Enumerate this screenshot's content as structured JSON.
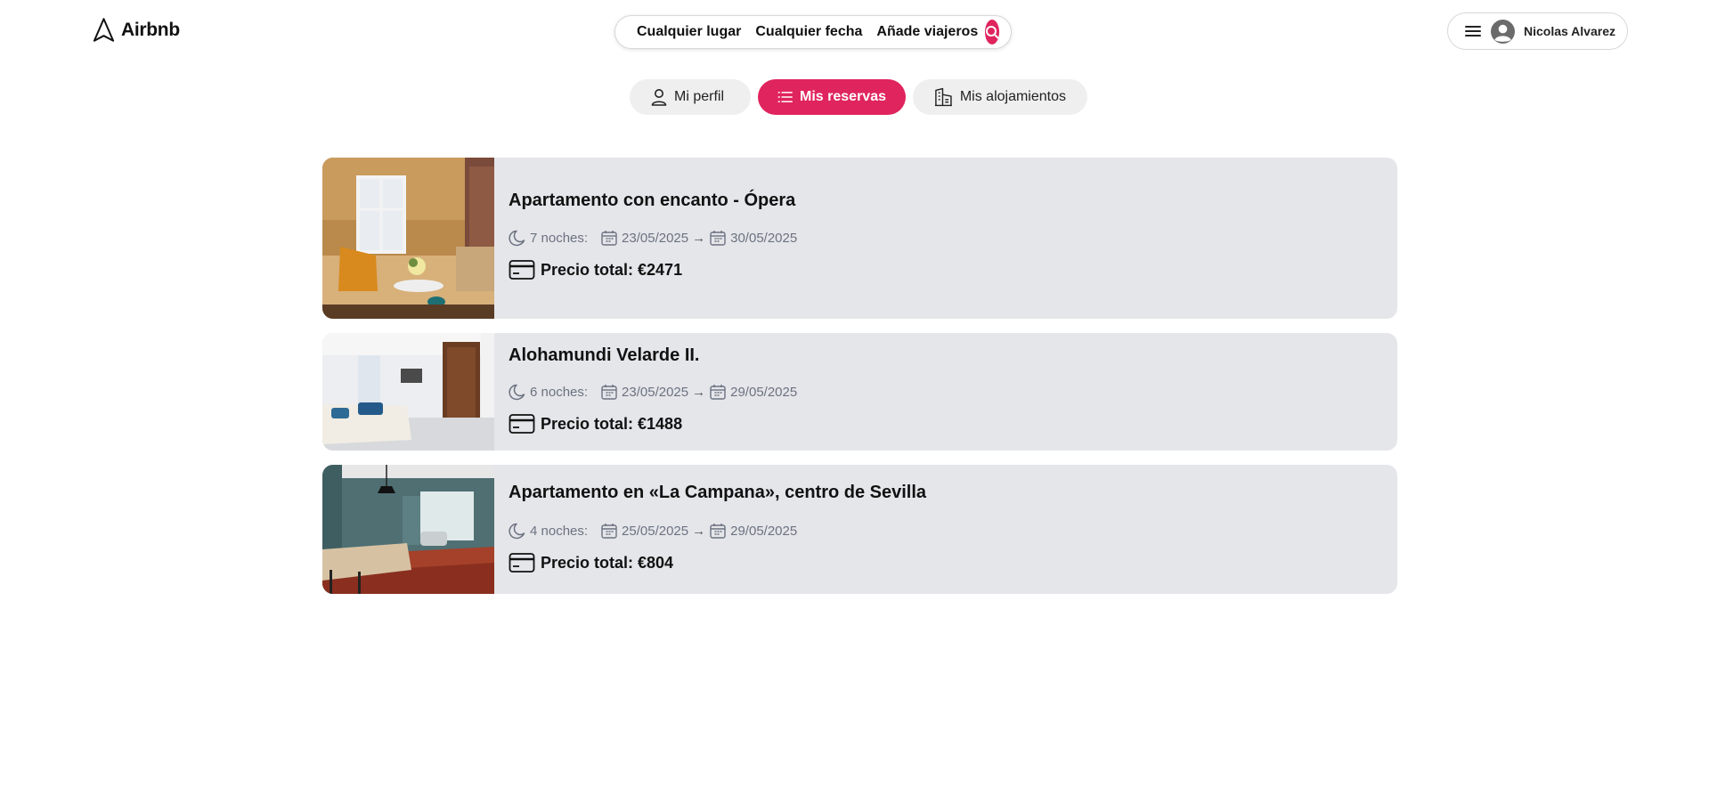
{
  "header": {
    "logo_label": "Airbnb",
    "search": {
      "place": "Cualquier lugar",
      "date": "Cualquier fecha",
      "guests": "Añade viajeros"
    },
    "user": {
      "name": "Nicolas Alvarez"
    }
  },
  "tabs": [
    {
      "label": "Mi perfil",
      "icon": "user-icon",
      "active": false
    },
    {
      "label": "Mis reservas",
      "icon": "list-icon",
      "active": true
    },
    {
      "label": "Mis alojamientos",
      "icon": "building-icon",
      "active": false
    }
  ],
  "bookings": [
    {
      "title": "Apartamento con encanto - Ópera",
      "nights": "7 noches:",
      "check_in": "23/05/2025",
      "check_out": "30/05/2025",
      "price": "Precio total: €2471"
    },
    {
      "title": "Alohamundi Velarde II.",
      "nights": "6 noches:",
      "check_in": "23/05/2025",
      "check_out": "29/05/2025",
      "price": "Precio total: €1488"
    },
    {
      "title": "Apartamento en «La Campana», centro de Sevilla",
      "nights": "4 noches:",
      "check_in": "25/05/2025",
      "check_out": "29/05/2025",
      "price": "Precio total: €804"
    }
  ],
  "arrow": "→",
  "colors": {
    "accent": "#e0245e",
    "card_bg": "#e5e6ea",
    "muted_text": "#6b7280"
  }
}
